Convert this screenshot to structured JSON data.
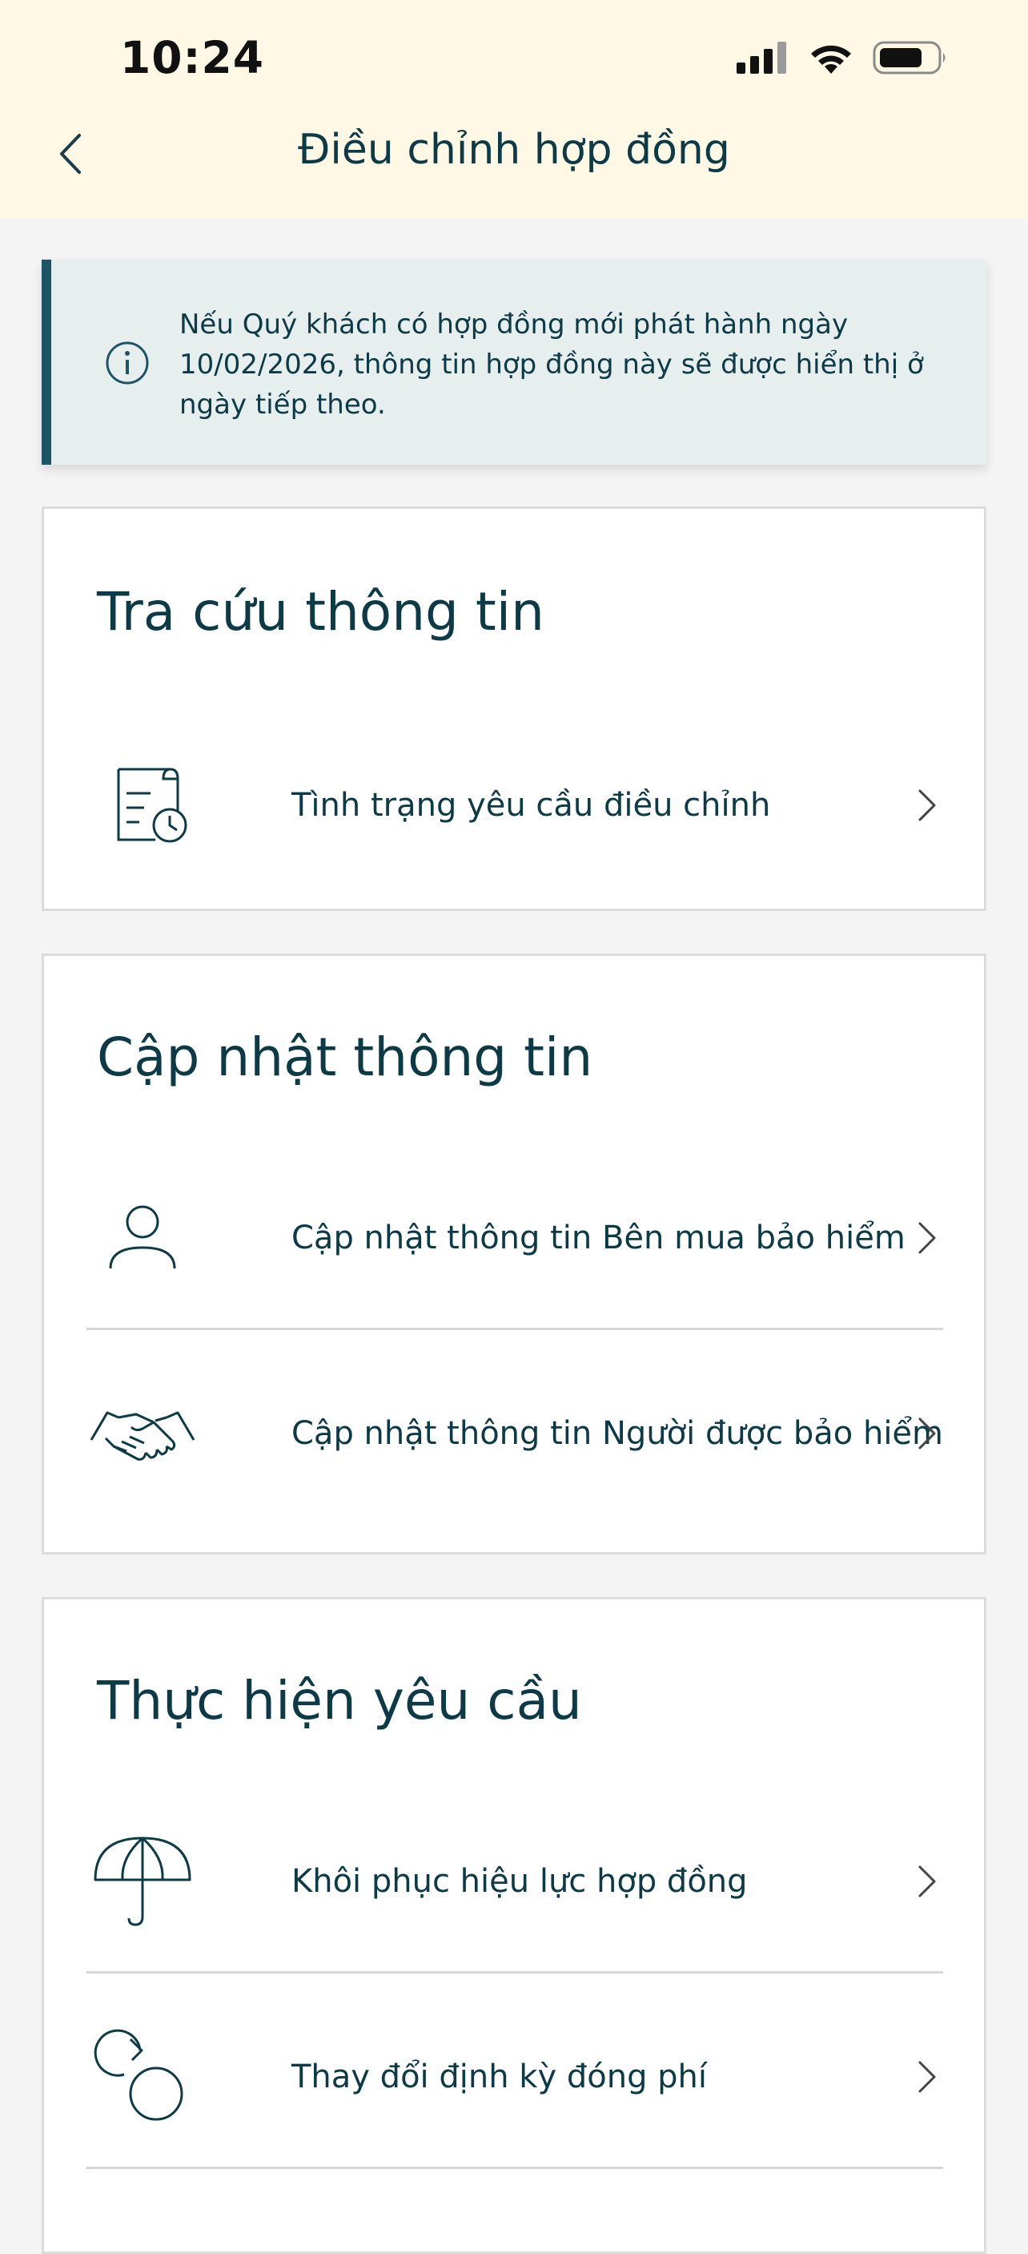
{
  "status_bar": {
    "time": "10:24"
  },
  "header": {
    "title": "Điều chỉnh hợp đồng"
  },
  "notice": {
    "text": "Nếu Quý khách có hợp đồng mới phát hành ngày 10/02/2026, thông tin hợp đồng này sẽ được hiển thị ở ngày tiếp theo."
  },
  "sections": {
    "lookup": {
      "title": "Tra cứu thông tin",
      "items": [
        {
          "label": "Tình trạng yêu cầu điều chỉnh",
          "icon": "document-clock-icon"
        }
      ]
    },
    "update": {
      "title": "Cập nhật thông tin",
      "items": [
        {
          "label": "Cập nhật thông tin Bên mua bảo hiểm",
          "icon": "person-icon"
        },
        {
          "label": "Cập nhật thông tin Người được bảo hiểm",
          "icon": "handshake-icon"
        }
      ]
    },
    "request": {
      "title": "Thực hiện yêu cầu",
      "items": [
        {
          "label": "Khôi phục hiệu lực hợp đồng",
          "icon": "umbrella-icon"
        },
        {
          "label": "Thay đổi định kỳ đóng phí",
          "icon": "cycle-icon"
        }
      ]
    }
  },
  "colors": {
    "header_bg": "#fef8e4",
    "accent": "#1e5467",
    "text": "#0c3a47",
    "notice_bg": "#e6eeee"
  }
}
